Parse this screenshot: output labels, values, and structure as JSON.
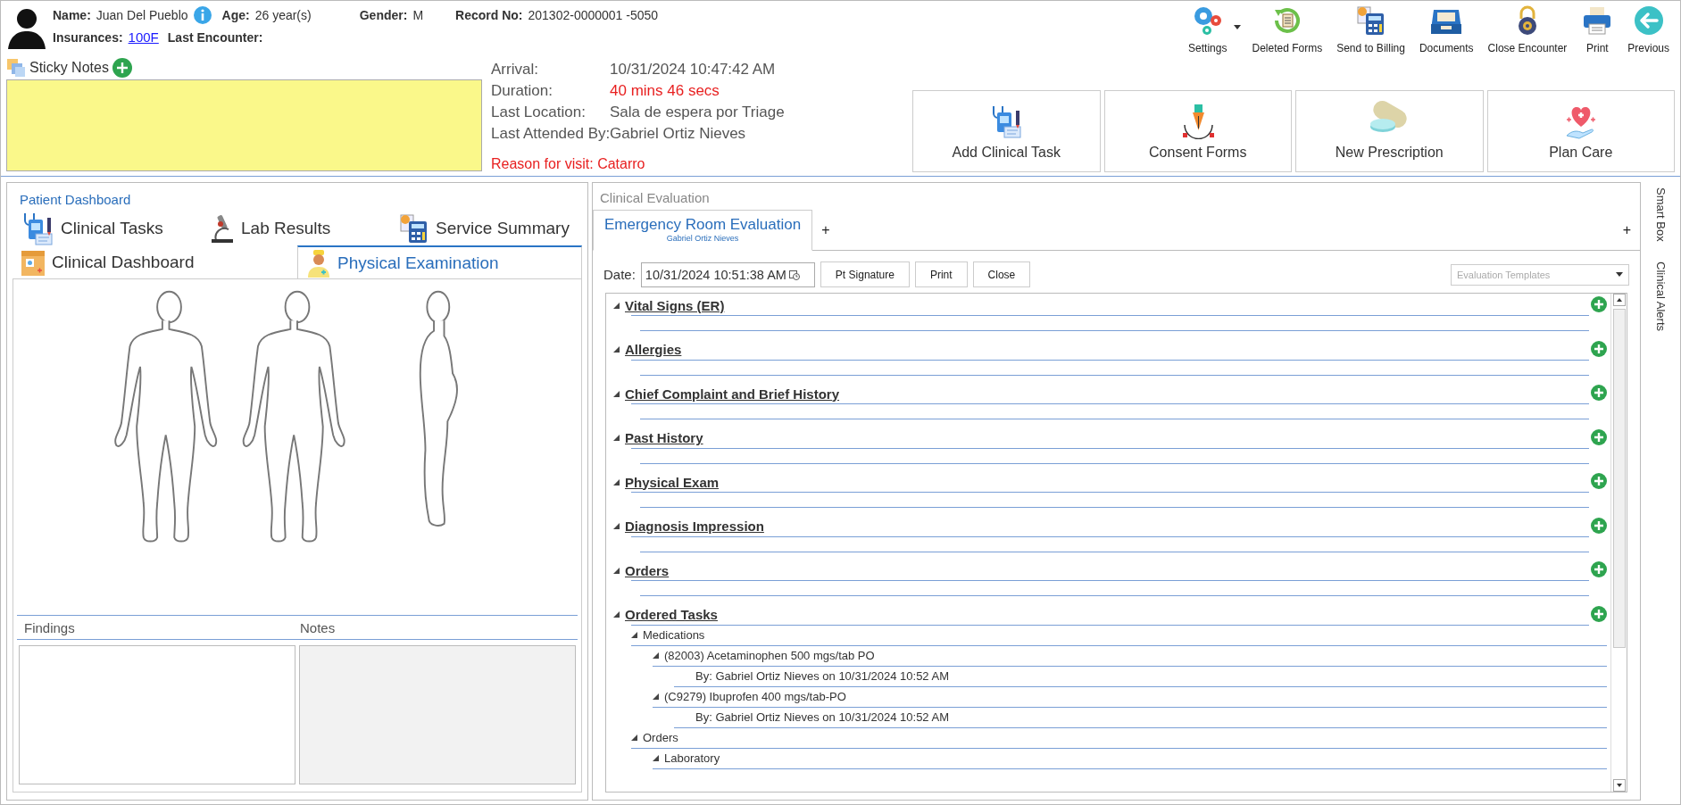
{
  "patient": {
    "name_label": "Name:",
    "name": "Juan Del Pueblo",
    "age_label": "Age:",
    "age": "26 year(s)",
    "gender_label": "Gender:",
    "gender": "M",
    "record_label": "Record No:",
    "record": "201302-0000001 -5050",
    "insurances_label": "Insurances:",
    "insurance": "100F",
    "last_encounter_label": "Last Encounter:"
  },
  "sticky_notes": {
    "title": "Sticky Notes"
  },
  "visit": [
    {
      "label": "Arrival:",
      "value": "10/31/2024 10:47:42 AM",
      "alert": false
    },
    {
      "label": "Duration:",
      "value": "40 mins 46 secs",
      "alert": true
    },
    {
      "label": "Last Location:",
      "value": "Sala de espera por Triage",
      "alert": false
    },
    {
      "label": "Last Attended By:",
      "value": "Gabriel Ortiz Nieves",
      "alert": false
    }
  ],
  "reason": "Reason for visit: Catarro",
  "toolbar": [
    {
      "label": "Settings",
      "dropdown": true
    },
    {
      "label": "Deleted Forms",
      "dropdown": false
    },
    {
      "label": "Send to Billing",
      "dropdown": false
    },
    {
      "label": "Documents",
      "dropdown": false
    },
    {
      "label": "Close Encounter",
      "dropdown": false
    },
    {
      "label": "Print",
      "dropdown": false
    },
    {
      "label": "Previous",
      "dropdown": false
    }
  ],
  "actions": [
    {
      "label": "Add Clinical Task"
    },
    {
      "label": "Consent Forms"
    },
    {
      "label": "New Prescription"
    },
    {
      "label": "Plan Care"
    }
  ],
  "patient_dashboard": {
    "title": "Patient Dashboard",
    "tab_rows": [
      [
        {
          "label": "Clinical Tasks",
          "selected": false
        },
        {
          "label": "Lab Results",
          "selected": false
        },
        {
          "label": "Service Summary",
          "selected": false
        }
      ],
      [
        {
          "label": "Clinical Dashboard",
          "selected": false
        },
        {
          "label": "Physical Examination",
          "selected": true
        }
      ]
    ],
    "findings_label": "Findings",
    "notes_label": "Notes"
  },
  "clinical_evaluation": {
    "title": "Clinical Evaluation",
    "tabs": [
      {
        "label": "Emergency Room Evaluation",
        "subtitle": "Gabriel Ortiz Nieves",
        "selected": true
      }
    ],
    "add_tab": "+",
    "add_right": "+",
    "date_label": "Date:",
    "date": "10/31/2024 10:51:38 AM",
    "buttons": [
      "Pt Signature",
      "Print",
      "Close"
    ],
    "templates_placeholder": "Evaluation Templates",
    "sections": [
      {
        "title": "Vital Signs (ER)",
        "expanded": true
      },
      {
        "title": "Allergies",
        "expanded": true
      },
      {
        "title": "Chief Complaint and Brief History",
        "expanded": true
      },
      {
        "title": "Past History",
        "expanded": true
      },
      {
        "title": "Physical Exam",
        "expanded": true
      },
      {
        "title": "Diagnosis Impression",
        "expanded": true
      },
      {
        "title": "Orders",
        "expanded": true
      },
      {
        "title": "Ordered Tasks",
        "expanded": true,
        "children": [
          {
            "label": "Medications",
            "expanded": true,
            "children": [
              {
                "label": "(82003) Acetaminophen 500 mgs/tab PO",
                "expanded": true,
                "children": [
                  {
                    "label": "By: Gabriel Ortiz Nieves on 10/31/2024 10:52 AM"
                  }
                ]
              },
              {
                "label": "(C9279) Ibuprofen 400 mgs/tab-PO",
                "expanded": true,
                "children": [
                  {
                    "label": "By: Gabriel Ortiz Nieves on 10/31/2024 10:52 AM"
                  }
                ]
              }
            ]
          },
          {
            "label": "Orders",
            "expanded": true,
            "children": [
              {
                "label": "Laboratory",
                "expanded": true
              }
            ]
          }
        ]
      }
    ]
  },
  "side_tabs": [
    "Smart Box",
    "Clinical Alerts"
  ]
}
